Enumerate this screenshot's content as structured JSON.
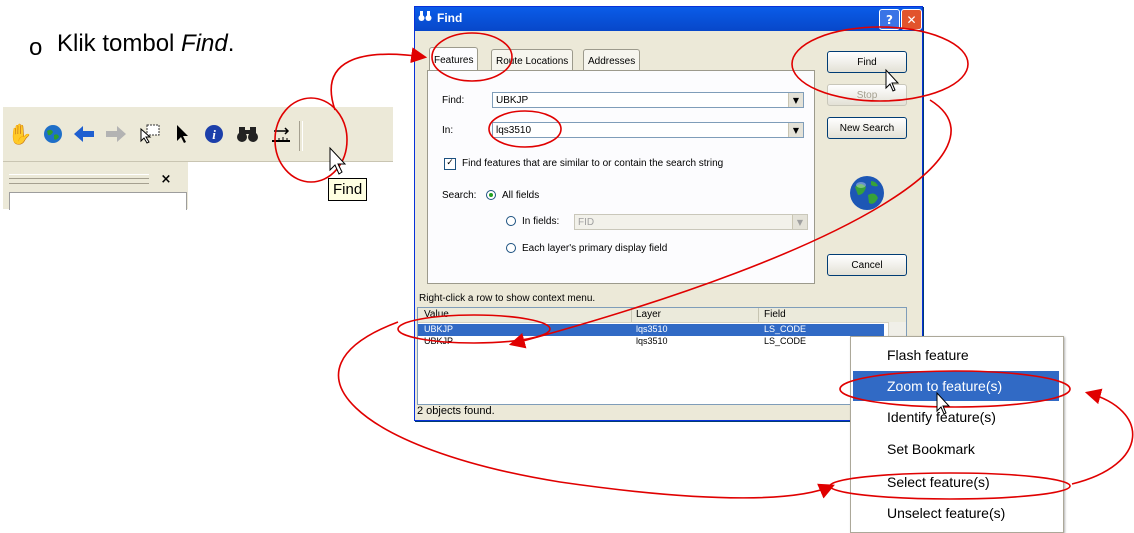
{
  "instruction": {
    "bullet": "o",
    "prefix": "Klik tombol ",
    "emph": "Find",
    "suffix": "."
  },
  "toolbar": {
    "tooltip": "Find",
    "dock_close": "×",
    "icons": [
      "pan-hand-icon",
      "globe-icon",
      "back-arrow-icon",
      "forward-arrow-icon",
      "select-features-icon",
      "pointer-arrow-icon",
      "identify-icon",
      "find-binoculars-icon",
      "measure-icon"
    ]
  },
  "dialog": {
    "title": "Find",
    "help_btn": "?",
    "close_btn": "✕",
    "tabs": [
      "Features",
      "Route Locations",
      "Addresses"
    ],
    "find_label": "Find:",
    "find_value": "UBKJP",
    "in_label": "In:",
    "in_value": "lqs3510",
    "similar_checkbox": "Find features that are similar to or contain the search string",
    "search_label": "Search:",
    "opt_all_fields": "All fields",
    "opt_in_fields": "In fields:",
    "in_fields_value": "FID",
    "opt_primary": "Each layer's primary display field",
    "buttons": {
      "find": "Find",
      "stop": "Stop",
      "new_search": "New Search",
      "cancel": "Cancel"
    },
    "results_hint": "Right-click a row to show context menu.",
    "columns": [
      "Value",
      "Layer",
      "Field"
    ],
    "rows": [
      {
        "value": "UBKJP",
        "layer": "lqs3510",
        "field": "LS_CODE"
      },
      {
        "value": "UBKJP",
        "layer": "lqs3510",
        "field": "LS_CODE"
      }
    ],
    "status": "2 objects found."
  },
  "context_menu": {
    "items": [
      "Flash feature",
      "Zoom to feature(s)",
      "Identify feature(s)",
      "Set Bookmark",
      "Select feature(s)",
      "Unselect feature(s)"
    ]
  },
  "colors": {
    "annotation": "#e00000",
    "highlight": "#316ac5",
    "titlebar": "#0a5ce8"
  }
}
